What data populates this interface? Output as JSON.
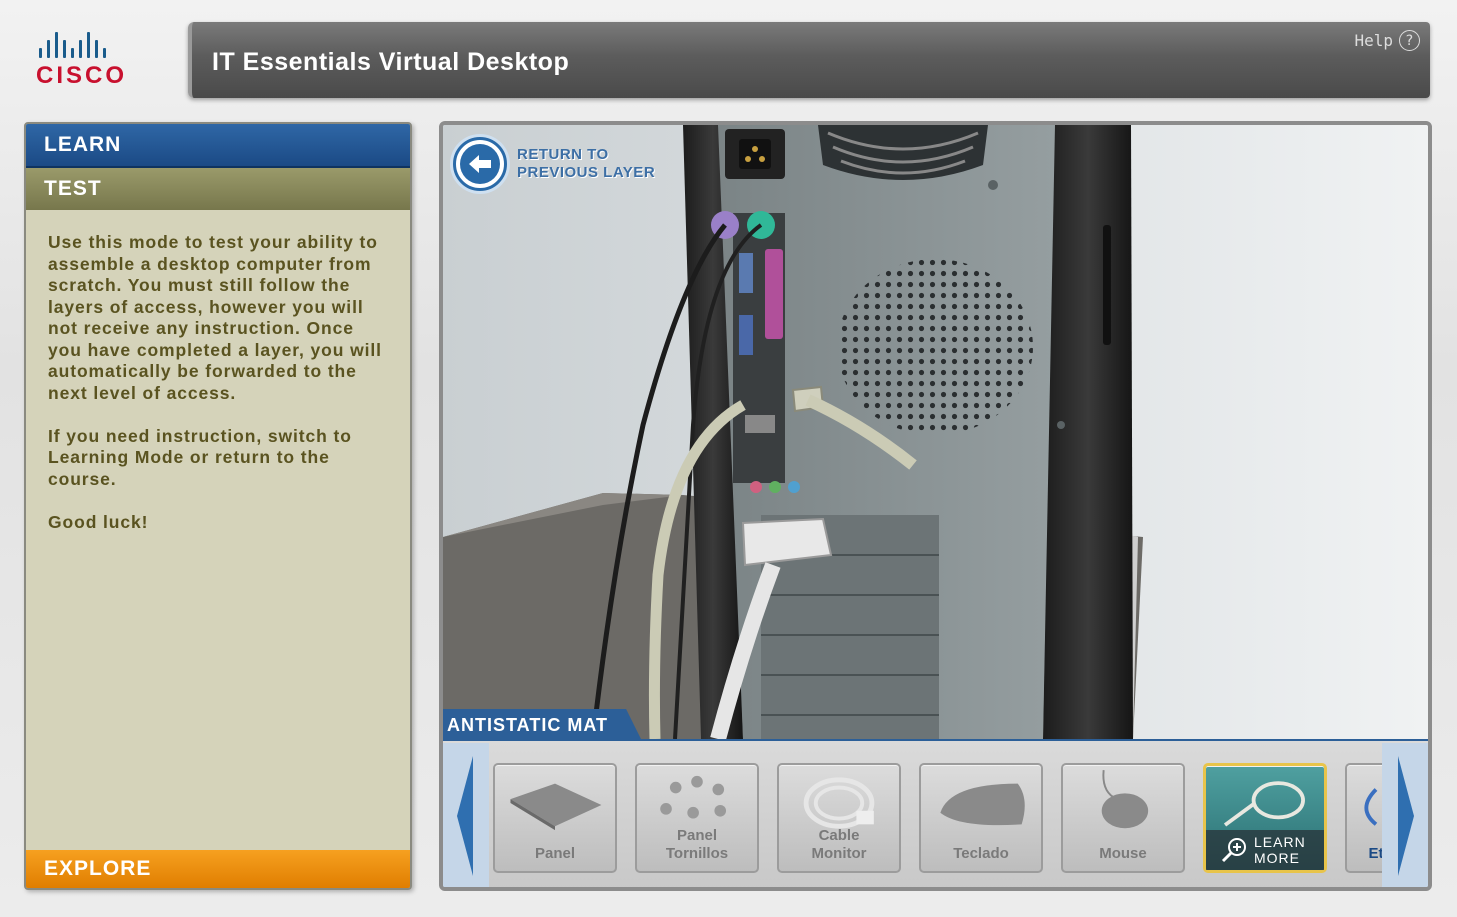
{
  "brand": {
    "logo_text": "CISCO"
  },
  "header": {
    "title": "IT Essentials Virtual Desktop",
    "help_label": "Help",
    "help_icon": "?"
  },
  "sidebar": {
    "tabs": [
      {
        "label": "LEARN"
      },
      {
        "label": "TEST"
      },
      {
        "label": "EXPLORE"
      }
    ],
    "description": [
      "Use this mode to test your ability to assemble a desktop computer from scratch. You must still follow the layers of access, however you will not receive any instruction. Once you have completed a layer, you will automatically be forwarded to the next level of access.",
      "If you need instruction, switch to Learning Mode or return to the course.",
      "Good luck!"
    ]
  },
  "viewer": {
    "return_button": {
      "line1": "RETURN TO",
      "line2": "PREVIOUS LAYER"
    },
    "section_label": "ANTISTATIC MAT",
    "tray_items": [
      {
        "line1": "",
        "line2": "Panel"
      },
      {
        "line1": "Panel",
        "line2": "Tornillos"
      },
      {
        "line1": "Cable",
        "line2": "Monitor"
      },
      {
        "line1": "",
        "line2": "Teclado"
      },
      {
        "line1": "",
        "line2": "Mouse"
      },
      {
        "learn_more_1": "LEARN",
        "learn_more_2": "MORE"
      },
      {
        "partial_label": "Et"
      }
    ]
  },
  "colors": {
    "learn_tab": "#1b4a85",
    "test_tab": "#77774c",
    "explore_tab": "#e07e00",
    "panel_bg": "#d5d3ba",
    "accent_blue": "#2c5f98"
  }
}
